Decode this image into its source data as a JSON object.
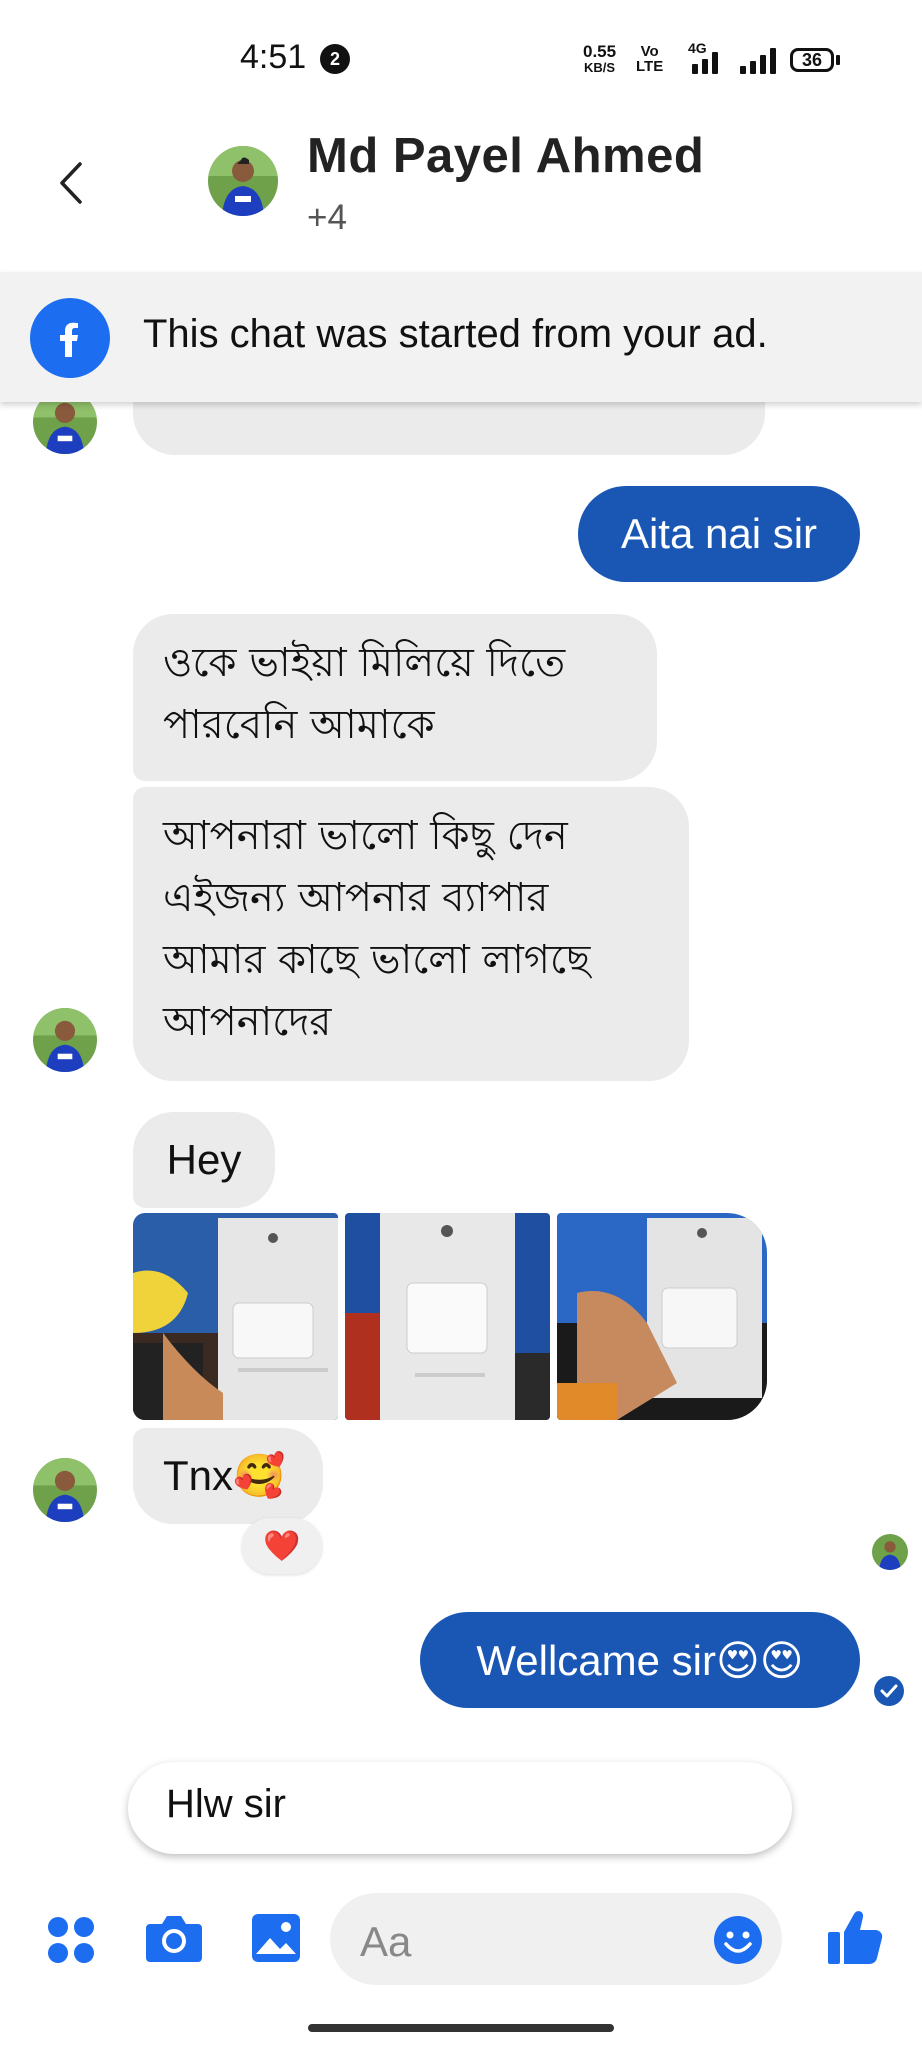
{
  "status_bar": {
    "time": "4:51",
    "notification_count": "2",
    "net_speed_value": "0.55",
    "net_speed_unit": "KB/S",
    "volte_top": "Vo",
    "volte_bottom": "LTE",
    "network": "4G",
    "battery": "36"
  },
  "header": {
    "contact_name": "Md Payel Ahmed",
    "participants_extra": "+4"
  },
  "banner": {
    "text": "This chat was started from your ad."
  },
  "messages": {
    "out_1": "Aita nai sir",
    "in_1_line1": "ওকে ভাইয়া মিলিয়ে দিতে",
    "in_1_line2": "পারবেনি আমাকে",
    "in_2_line1": "আপনারা ভালো কিছু দেন",
    "in_2_line2": "এইজন্য আপনার ব্যাপার",
    "in_2_line3": "আমার কাছে ভালো লাগছে",
    "in_2_line4": "আপনাদের",
    "in_3": "Hey",
    "in_4": "Tnx🥰",
    "in_4_reaction": "❤️",
    "out_2": "Wellcame sir😍😍"
  },
  "suggested_reply": "Hlw sir",
  "composer": {
    "placeholder": "Aa"
  },
  "colors": {
    "outgoing_bubble": "#1a57b5",
    "incoming_bubble": "#ebebeb",
    "messenger_blue": "#1d6df0"
  },
  "icons": [
    "back-icon",
    "facebook-icon",
    "menu-dots-icon",
    "camera-icon",
    "gallery-icon",
    "emoji-icon",
    "thumbs-up-icon",
    "read-receipt-icon"
  ]
}
